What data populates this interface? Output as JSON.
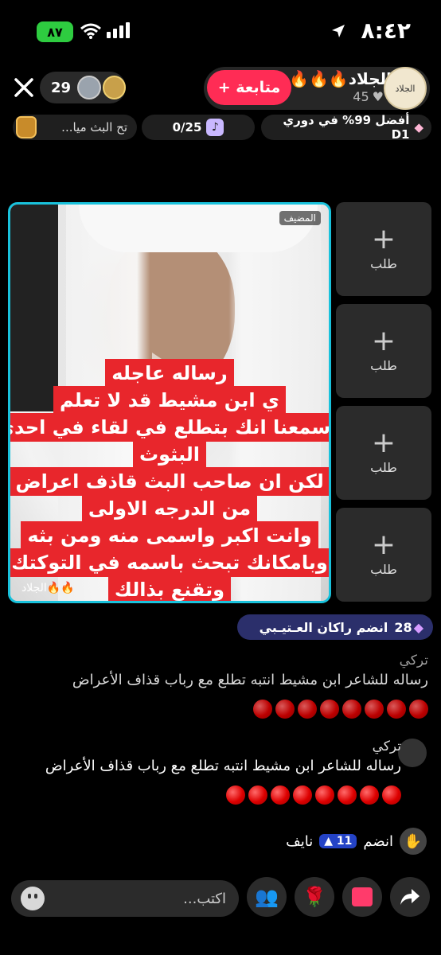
{
  "status_bar": {
    "time": "٨:٤٢",
    "battery": "٨٧"
  },
  "header": {
    "viewer_count": "29",
    "follow_label": "+ متابعة",
    "host_name": "الجلاد🔥🔥🔥",
    "host_likes": "45",
    "host_avatar_text": "الجلاد"
  },
  "info_row": {
    "rank_text": "أفضل 99% في دوري D1",
    "goal_text": "0/25",
    "gift_text": "تح  البث ميا..."
  },
  "video": {
    "host_tag": "المضيف",
    "caption_tag": "الجلاد🔥🔥",
    "overlay_lines": [
      "رساله عاجله",
      "ي ابن مشيط  قد لا تعلم",
      "وسمعنا انك بتطلع في لقاء في احدى",
      "البثوث",
      "لكن ان صاحب البث قاذف  اعراض",
      "من الدرجه الاولى",
      "وانت اكبر واسمى  منه ومن بثه",
      "وبامكانك تبحث باسمه في التوكتك",
      "وتقنع بذالك"
    ]
  },
  "slots": [
    {
      "label": "طلب"
    },
    {
      "label": "طلب"
    },
    {
      "label": "طلب"
    },
    {
      "label": "طلب"
    }
  ],
  "join_banner": {
    "count": "28",
    "text": "انضم راكان العـتيـبي"
  },
  "comments": [
    {
      "user": "تركي",
      "message": "رساله للشاعر ابن مشيط انتبه تطلع مع رباب قذاف الأعراض"
    },
    {
      "user": "تركي",
      "message": "رساله للشاعر ابن مشيط انتبه تطلع مع رباب قذاف الأعراض"
    }
  ],
  "join_line": {
    "action": "انضم",
    "level": "11",
    "name": "نايف"
  },
  "bottom_bar": {
    "placeholder": "اكتب..."
  }
}
